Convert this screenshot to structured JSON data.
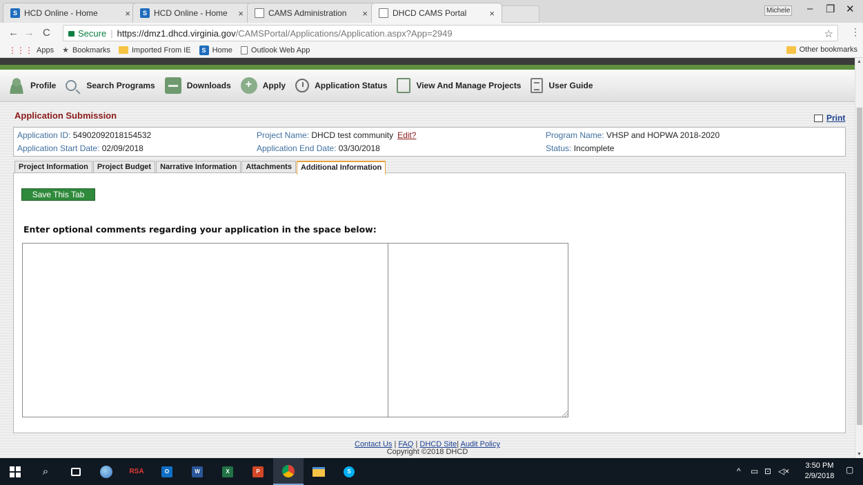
{
  "browser": {
    "tabs": [
      {
        "title": "HCD Online - Home",
        "icon": "sharepoint-icon"
      },
      {
        "title": "HCD Online - Home",
        "icon": "sharepoint-icon"
      },
      {
        "title": "CAMS Administration",
        "icon": "page-icon"
      },
      {
        "title": "DHCD CAMS Portal",
        "icon": "page-icon"
      }
    ],
    "close_glyph": "×",
    "window_user": "Michele",
    "secure_label": "Secure",
    "url_host": "https://dmz1.dhcd.virginia.gov",
    "url_path": "/CAMSPortal/Applications/Application.aspx?App=2949",
    "bookmarks": [
      "Apps",
      "Bookmarks",
      "Imported From IE",
      "Home",
      "Outlook Web App"
    ],
    "other_bookmarks": "Other bookmarks"
  },
  "menu": {
    "items": [
      {
        "label": "Profile",
        "icon": "profile-icon"
      },
      {
        "label": "Search Programs",
        "icon": "search-icon"
      },
      {
        "label": "Downloads",
        "icon": "downloads-icon"
      },
      {
        "label": "Apply",
        "icon": "apply-icon"
      },
      {
        "label": "Application Status",
        "icon": "clock-icon"
      },
      {
        "label": "View And Manage Projects",
        "icon": "manage-projects-icon"
      },
      {
        "label": "User Guide",
        "icon": "user-guide-icon"
      }
    ]
  },
  "page": {
    "title": "Application Submission",
    "print_label": "Print",
    "info": {
      "app_id_label": "Application ID:",
      "app_id": "54902092018154532",
      "start_label": "Application Start Date:",
      "start": "02/09/2018",
      "project_label": "Project Name:",
      "project": "DHCD test community",
      "edit_label": "Edit?",
      "end_label": "Application End Date:",
      "end": "03/30/2018",
      "program_label": "Program Name:",
      "program": "VHSP and HOPWA 2018-2020",
      "status_label": "Status:",
      "status": "Incomplete"
    },
    "tabs": [
      "Project Information",
      "Project Budget",
      "Narrative Information",
      "Attachments",
      "Additional Information"
    ],
    "active_tab": "Additional Information",
    "save_button": "Save This Tab",
    "instructions": "Enter optional comments regarding your application in the space below:",
    "comments_value": ""
  },
  "footer": {
    "links": [
      "Contact Us",
      "FAQ",
      "DHCD Site",
      "Audit Policy"
    ],
    "copyright": "Copyright ©2018 DHCD"
  },
  "taskbar": {
    "rsa_label": "RSA",
    "time": "3:50 PM",
    "date": "2/9/2018"
  },
  "colors": {
    "accent_green": "#5e8f3f",
    "title_red": "#8b1a1a",
    "tab_highlight": "#e6a23c",
    "save_green": "#2f8a3b"
  }
}
